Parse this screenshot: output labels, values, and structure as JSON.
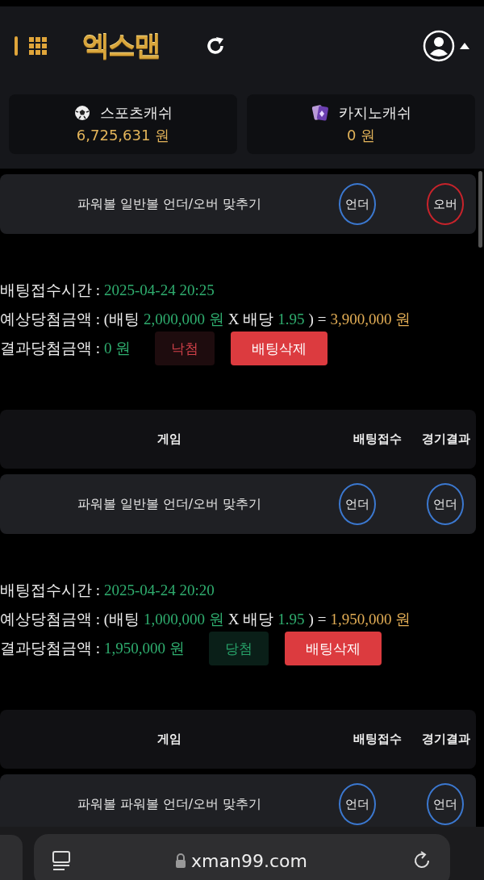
{
  "header": {
    "logo": "엑스맨"
  },
  "wallets": [
    {
      "kind": "sports",
      "label": "스포츠캐쉬",
      "amount": "6,725,631 원"
    },
    {
      "kind": "casino",
      "label": "카지노캐쉬",
      "amount": "0 원"
    }
  ],
  "blocks": [
    {
      "kind": "game",
      "title": "파워볼 일반볼 언더/오버 맞추기",
      "picks": [
        {
          "label": "언더",
          "color": "#3b78d0"
        },
        {
          "label": "오버",
          "color": "#c8232b"
        }
      ]
    },
    {
      "kind": "bet",
      "lines": [
        [
          {
            "text": "배팅접수시간 :",
            "color": "#eeeeee"
          },
          {
            "text": "2025-04-24 20:25",
            "color": "#2fae6f"
          }
        ],
        [
          {
            "text": "예상당첨금액 : (배팅",
            "color": "#eeeeee"
          },
          {
            "text": "2,000,000 원",
            "color": "#2fae6f"
          },
          {
            "text": "X 배당",
            "color": "#eeeeee"
          },
          {
            "text": "1.95",
            "color": "#2fae6f"
          },
          {
            "text": ") =",
            "color": "#eeeeee"
          },
          {
            "text": "3,900,000 원",
            "color": "#e2ad55"
          }
        ],
        [
          {
            "text": "결과당첨금액 :",
            "color": "#eeeeee"
          },
          {
            "text": "0 원",
            "color": "#2fae6f"
          }
        ]
      ],
      "result": {
        "label": "낙첨",
        "won": false
      },
      "delete_button": "배팅삭제"
    },
    {
      "kind": "header",
      "columns": [
        "게임",
        "배팅접수",
        "경기결과"
      ]
    },
    {
      "kind": "game",
      "title": "파워볼 일반볼 언더/오버 맞추기",
      "picks": [
        {
          "label": "언더",
          "color": "#3b78d0"
        },
        {
          "label": "언더",
          "color": "#3b78d0"
        }
      ]
    },
    {
      "kind": "bet",
      "lines": [
        [
          {
            "text": "배팅접수시간 :",
            "color": "#eeeeee"
          },
          {
            "text": "2025-04-24 20:20",
            "color": "#2fae6f"
          }
        ],
        [
          {
            "text": "예상당첨금액 : (배팅",
            "color": "#eeeeee"
          },
          {
            "text": "1,000,000 원",
            "color": "#2fae6f"
          },
          {
            "text": "X 배당",
            "color": "#eeeeee"
          },
          {
            "text": "1.95",
            "color": "#2fae6f"
          },
          {
            "text": ") =",
            "color": "#eeeeee"
          },
          {
            "text": "1,950,000 원",
            "color": "#e2ad55"
          }
        ],
        [
          {
            "text": "결과당첨금액 :",
            "color": "#eeeeee"
          },
          {
            "text": "1,950,000 원",
            "color": "#2fae6f"
          }
        ]
      ],
      "result": {
        "label": "당첨",
        "won": true
      },
      "delete_button": "배팅삭제"
    },
    {
      "kind": "header",
      "columns": [
        "게임",
        "배팅접수",
        "경기결과"
      ]
    },
    {
      "kind": "game",
      "title": "파워볼 파워볼 언더/오버 맞추기",
      "picks": [
        {
          "label": "언더",
          "color": "#3b78d0"
        },
        {
          "label": "언더",
          "color": "#3b78d0"
        }
      ]
    }
  ],
  "browser": {
    "url": "xman99.com"
  }
}
